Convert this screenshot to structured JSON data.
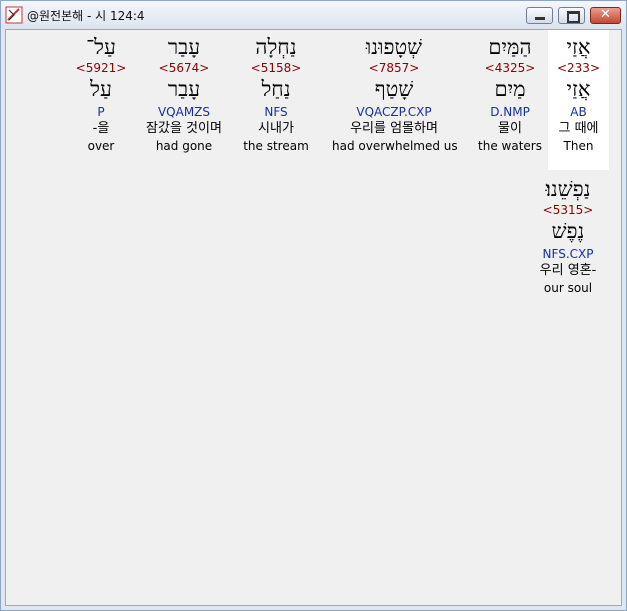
{
  "window": {
    "title": "@원전본해 - 시 124:4"
  },
  "rows": [
    [
      {
        "surface": "אֲזַי",
        "strong": "<233>",
        "lemma": "אֲזַי",
        "parse": "AB",
        "korean": "그 때에",
        "english": "Then"
      },
      {
        "surface": "הַמַּיִם",
        "strong": "<4325>",
        "lemma": "מַיִם",
        "parse": "D.NMP",
        "korean": "물이",
        "english": "the waters"
      },
      {
        "surface": "שְׁטָפוּנוּ",
        "strong": "<7857>",
        "lemma": "שָׁטַף",
        "parse": "VQACZP.CXP",
        "korean": "우리를 엄몰하며",
        "english": "had overwhelmed us"
      },
      {
        "surface": "נַחְלָה",
        "strong": "<5158>",
        "lemma": "נַחַל",
        "parse": "NFS",
        "korean": "시내가",
        "english": "the stream"
      },
      {
        "surface": "עָבַר",
        "strong": "<5674>",
        "lemma": "עָבַר",
        "parse": "VQAMZS",
        "korean": "잠갔을 것이며",
        "english": "had gone"
      },
      {
        "surface": "עַל־",
        "strong": "<5921>",
        "lemma": "עַל",
        "parse": "P",
        "korean": "-을",
        "english": "over"
      }
    ],
    [
      {
        "surface": "נַפְשֵׁנוּ׃",
        "strong": "<5315>",
        "lemma": "נֶפֶשׁ",
        "parse": "NFS.CXP",
        "korean": "우리 영혼-",
        "english": "our soul"
      }
    ]
  ]
}
